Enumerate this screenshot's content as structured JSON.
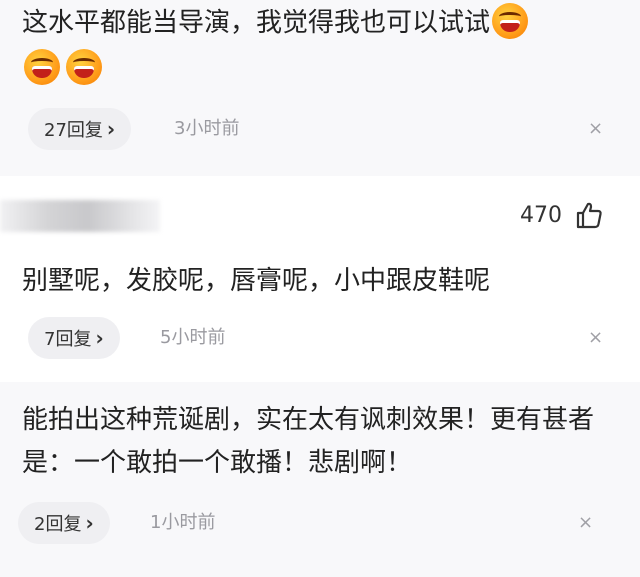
{
  "comments": [
    {
      "text": "这水平都能当导演，我觉得我也可以试试",
      "emoji_icon": "grinning-squint-face-icon",
      "reply_label": "27回复",
      "time": "3小时前",
      "close_glyph": "×"
    },
    {
      "likes": "470",
      "text": "别墅呢，发胶呢，唇膏呢，小中跟皮鞋呢",
      "reply_label": "7回复",
      "time": "5小时前",
      "close_glyph": "×"
    },
    {
      "text": "能拍出这种荒诞剧，实在太有讽刺效果！更有甚者是：一个敢拍一个敢播！悲剧啊！",
      "reply_label": "2回复",
      "time": "1小时前",
      "close_glyph": "×"
    }
  ],
  "chevron_glyph": "›"
}
